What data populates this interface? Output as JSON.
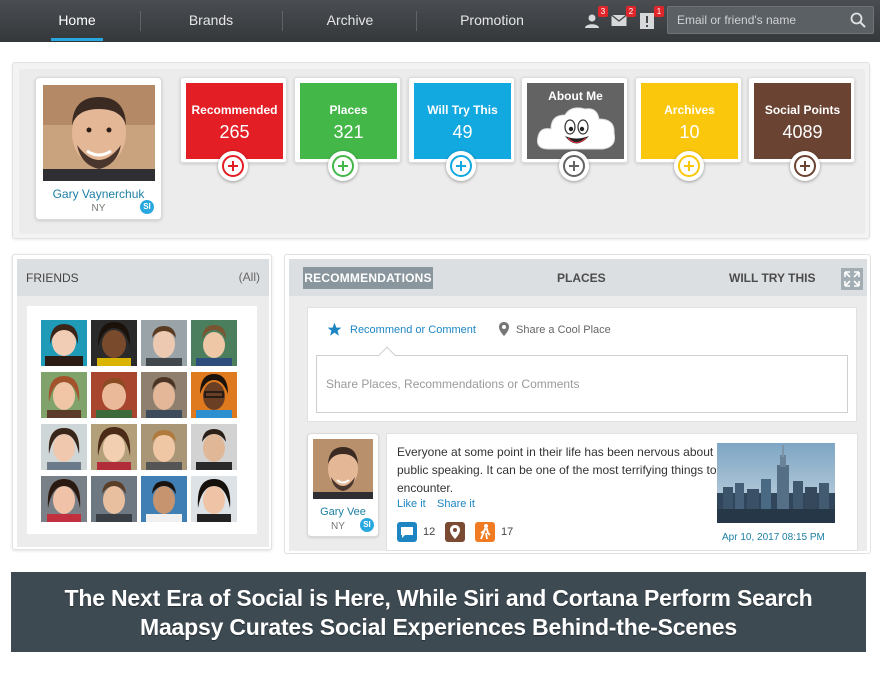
{
  "nav": {
    "items": [
      {
        "label": "Home",
        "active": true
      },
      {
        "label": "Brands",
        "active": false
      },
      {
        "label": "Archive",
        "active": false
      },
      {
        "label": "Promotion",
        "active": false
      }
    ],
    "notifications": {
      "friends": "3",
      "messages": "2",
      "alerts": "1"
    },
    "search_placeholder": "Email or friend's name"
  },
  "profile": {
    "name": "Gary Vaynerchuk",
    "location": "NY",
    "badge": "SI"
  },
  "stats": [
    {
      "label": "Recommended",
      "value": "265",
      "color": "#e31e25"
    },
    {
      "label": "Places",
      "value": "321",
      "color": "#44b749"
    },
    {
      "label": "Will Try This",
      "value": "49",
      "color": "#12a8e0"
    },
    {
      "label": "About Me",
      "value": "",
      "color": "#636363"
    },
    {
      "label": "Archives",
      "value": "10",
      "color": "#fbc70d"
    },
    {
      "label": "Social Points",
      "value": "4089",
      "color": "#6b4332"
    }
  ],
  "friends": {
    "title": "FRIENDS",
    "filter": "(All)",
    "count_shown": 16
  },
  "feed": {
    "tabs": {
      "recommendations": "RECOMMENDATIONS",
      "places": "PLACES",
      "will_try": "WILL TRY THIS"
    },
    "compose": {
      "option_recommend": "Recommend or Comment",
      "option_share": "Share a Cool Place",
      "placeholder": "Share Places, Recommendations or Comments"
    },
    "post": {
      "author": "Gary Vee",
      "location": "NY",
      "badge": "SI",
      "text": "Everyone at some point in their life has been nervous about public speaking. It can be one of the most terrifying things to encounter.",
      "like": "Like it",
      "share": "Share it",
      "comment_count": "12",
      "try_count": "17",
      "date": "Apr 10, 2017  08:15 PM"
    }
  },
  "banner": {
    "line1": "The Next Era of Social is Here, While Siri and Cortana Perform Search",
    "line2": "Maapsy Curates Social Experiences Behind-the-Scenes"
  },
  "colors": {
    "accent": "#29a8e0",
    "nav_bg": "#3c4043",
    "banner_bg": "#3e4a52"
  }
}
